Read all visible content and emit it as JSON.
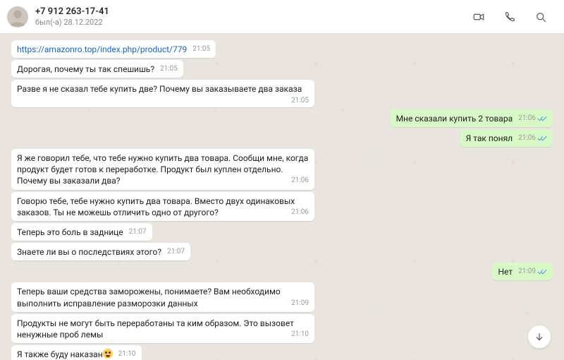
{
  "header": {
    "contact_name": "+7 912 263-17-41",
    "status_text": "был(-а) 28.12.2022"
  },
  "messages": [
    {
      "side": "in",
      "text": "https://amazonro.top/index.php/product/779",
      "time": "21:05",
      "link": true
    },
    {
      "side": "in",
      "text": "Дорогая, почему ты так спешишь?",
      "time": "21:05"
    },
    {
      "side": "in",
      "text": "Разве я не сказал тебе купить две? Почему вы заказываете два заказа",
      "time": "21:05"
    },
    {
      "side": "out",
      "text": "Мне сказали купить 2 товара",
      "time": "21:06"
    },
    {
      "side": "out",
      "text": "Я так понял",
      "time": "21:06"
    },
    {
      "side": "in",
      "text": "Я же говорил тебе, что тебе нужно купить два товара. Сообщи мне, когда продукт будет готов к переработке. Продукт был куплен отдельно. Почему вы заказали два?",
      "time": "21:06"
    },
    {
      "side": "in",
      "text": "Говорю тебе, тебе нужно купить два товара. Вместо двух одинаковых заказов. Ты не можешь отличить одно от другого?",
      "time": "21:06"
    },
    {
      "side": "in",
      "text": "Теперь это боль в заднице",
      "time": "21:07"
    },
    {
      "side": "in",
      "text": "Знаете ли вы о последствиях этого?",
      "time": "21:07"
    },
    {
      "side": "out",
      "text": "Нет",
      "time": "21:09"
    },
    {
      "side": "in",
      "text": "Теперь ваши средства заморожены, понимаете? Вам необходимо выполнить исправление разморозки данных",
      "time": "21:09"
    },
    {
      "side": "in",
      "text": "Продукты не могут быть переработаны та ким образом. Это вызовет ненужные проб лемы",
      "time": "21:10"
    },
    {
      "side": "in",
      "text": "Я также буду наказан",
      "time": "21:10",
      "emoji": true
    }
  ]
}
